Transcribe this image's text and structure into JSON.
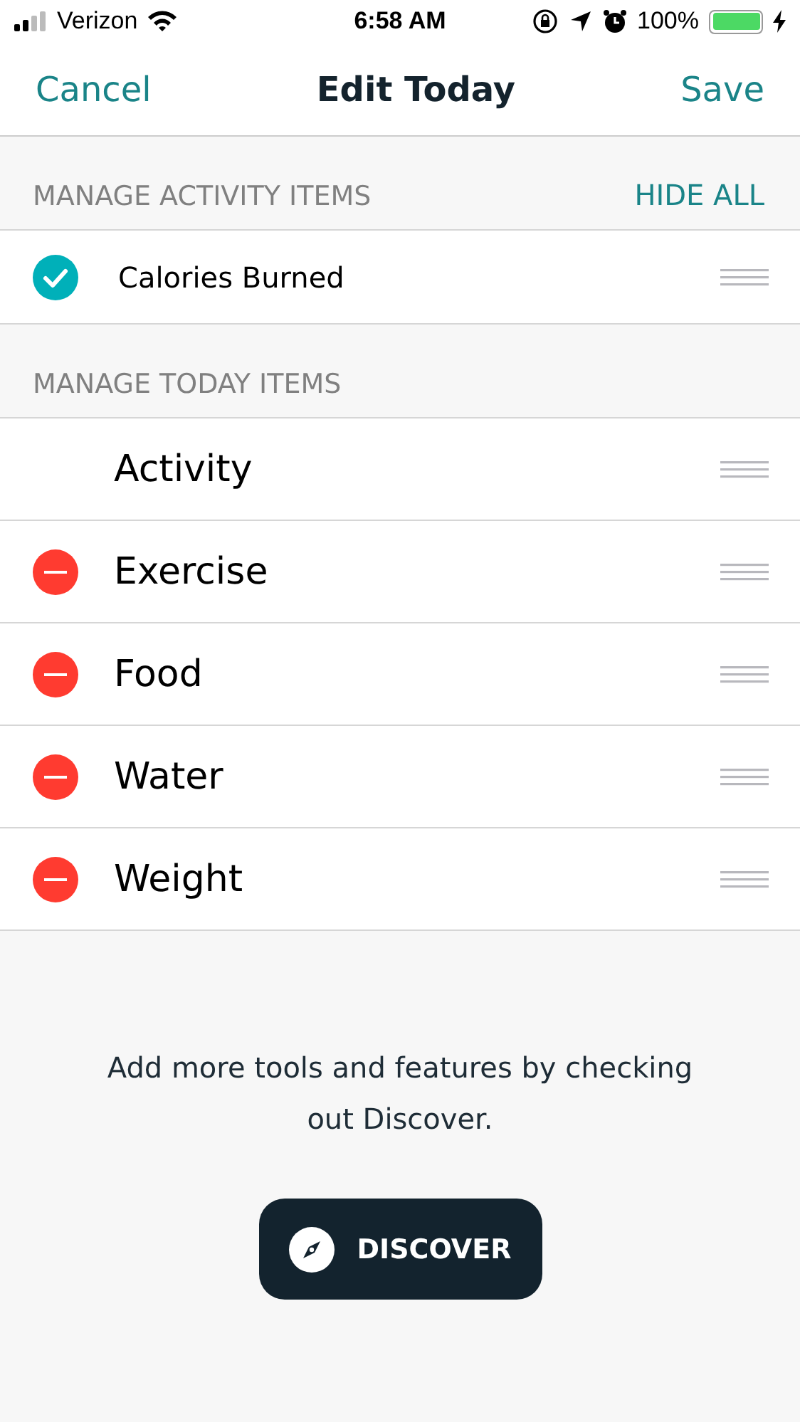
{
  "status_bar": {
    "carrier": "Verizon",
    "time": "6:58 AM",
    "battery": "100%"
  },
  "nav": {
    "cancel": "Cancel",
    "title": "Edit Today",
    "save": "Save"
  },
  "activity_section": {
    "header": "MANAGE ACTIVITY ITEMS",
    "action": "HIDE ALL",
    "items": [
      {
        "label": "Calories Burned",
        "checked": true
      }
    ]
  },
  "today_section": {
    "header": "MANAGE TODAY ITEMS",
    "items": [
      {
        "label": "Activity",
        "kind": "fixed"
      },
      {
        "label": "Exercise",
        "kind": "removable"
      },
      {
        "label": "Food",
        "kind": "removable"
      },
      {
        "label": "Water",
        "kind": "removable"
      },
      {
        "label": "Weight",
        "kind": "removable"
      }
    ]
  },
  "footer": {
    "message": "Add more tools and features by checking out Discover.",
    "button": "DISCOVER"
  }
}
